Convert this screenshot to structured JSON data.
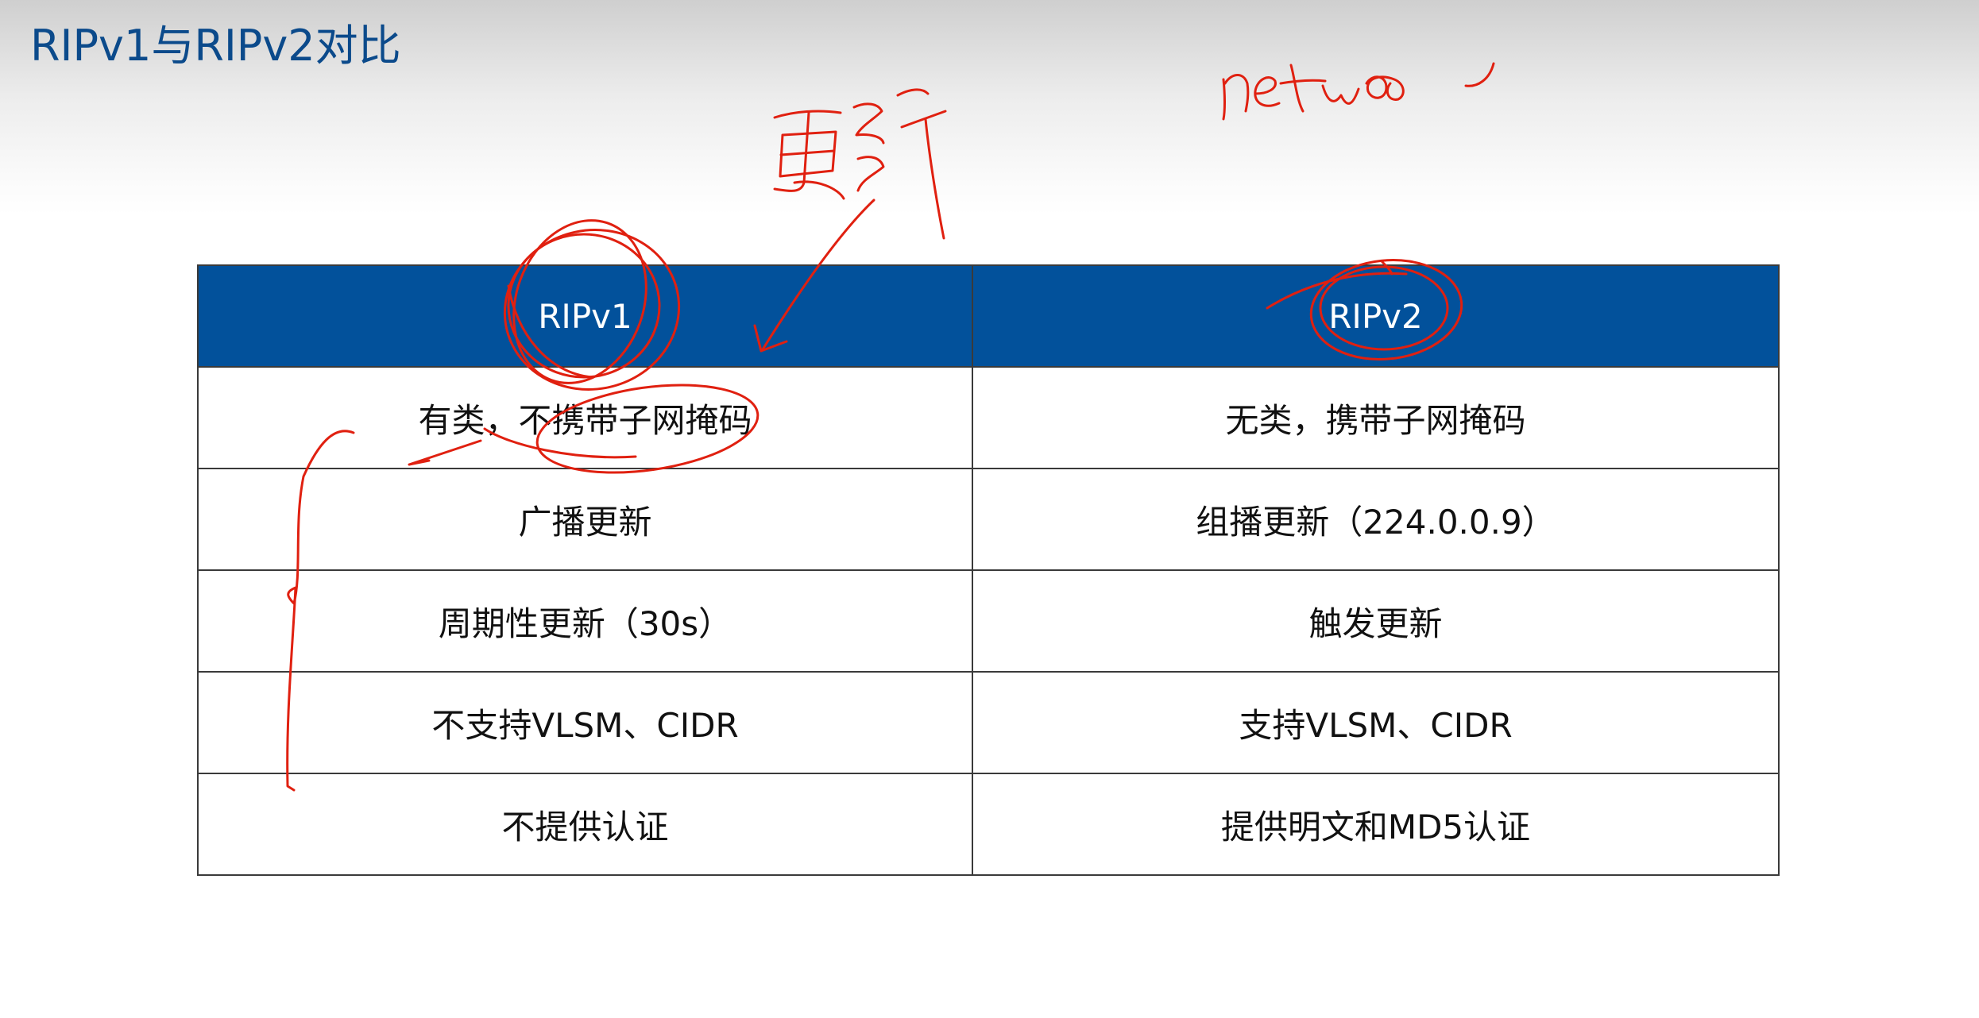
{
  "slide": {
    "title": "RIPv1与RIPv2对比"
  },
  "table": {
    "headers": [
      "RIPv1",
      "RIPv2"
    ],
    "rows": [
      [
        "有类，不携带子网掩码",
        "无类，携带子网掩码"
      ],
      [
        "广播更新",
        "组播更新（224.0.0.9）"
      ],
      [
        "周期性更新（30s）",
        "触发更新"
      ],
      [
        "不支持VLSM、CIDR",
        "支持VLSM、CIDR"
      ],
      [
        "不提供认证",
        "提供明文和MD5认证"
      ]
    ]
  },
  "annotations": {
    "color": "#e02010",
    "handwriting": [
      "更新",
      "netwo"
    ]
  },
  "theme": {
    "title_color": "#0b4a8b",
    "header_bg": "#02519b",
    "border_color": "#3a3a3a"
  }
}
